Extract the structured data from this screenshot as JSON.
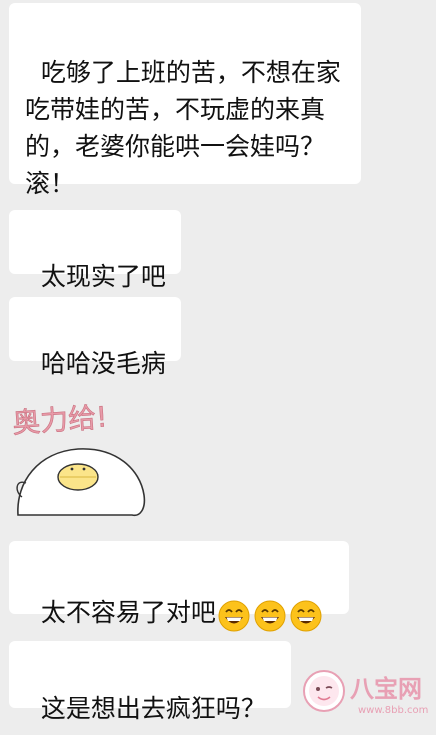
{
  "messages": [
    {
      "text": "吃够了上班的苦，不想在家吃带娃的苦，不玩虚的来真的，老婆你能哄一会娃吗？      滚！"
    },
    {
      "text": "太现实了吧"
    },
    {
      "text": "哈哈没毛病"
    },
    {
      "sticker_text": "奥力给!",
      "sticker_icon": "duck-chick-sticker"
    },
    {
      "text": "太不容易了对吧",
      "emojis": [
        "grinning-face-icon",
        "grinning-face-icon",
        "grinning-face-icon"
      ]
    },
    {
      "text": "这是想出去疯狂吗？"
    }
  ],
  "watermark": {
    "brand": "八宝网",
    "url": "www.8bb.com"
  },
  "colors": {
    "background": "#ededed",
    "bubble": "#ffffff",
    "sticker_text": "#e89aa8",
    "watermark": "#e8a0b4"
  }
}
